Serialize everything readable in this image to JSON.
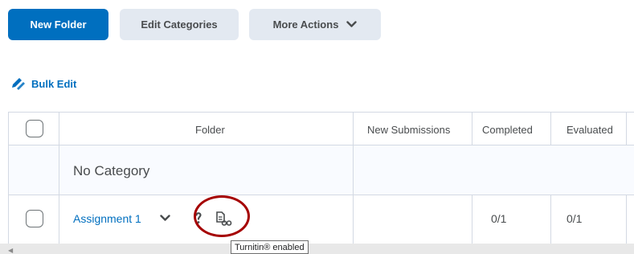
{
  "toolbar": {
    "new_folder_label": "New Folder",
    "edit_categories_label": "Edit Categories",
    "more_actions_label": "More Actions"
  },
  "bulk_edit": {
    "label": "Bulk Edit"
  },
  "table": {
    "headers": [
      "Folder",
      "New Submissions",
      "Completed",
      "Evaluated"
    ],
    "category": "No Category",
    "rows": [
      {
        "folder": "Assignment 1",
        "new_submissions": "",
        "completed": "0/1",
        "evaluated": "0/1"
      }
    ]
  },
  "tooltip": {
    "text": "Turnitin® enabled"
  },
  "icons": [
    "chevron-down-icon",
    "pencil-icon",
    "help-icon",
    "turnitin-icon"
  ],
  "colors": {
    "primary": "#006fbf",
    "secondary_bg": "#e3e9f1",
    "highlight_circle": "#a50000"
  }
}
